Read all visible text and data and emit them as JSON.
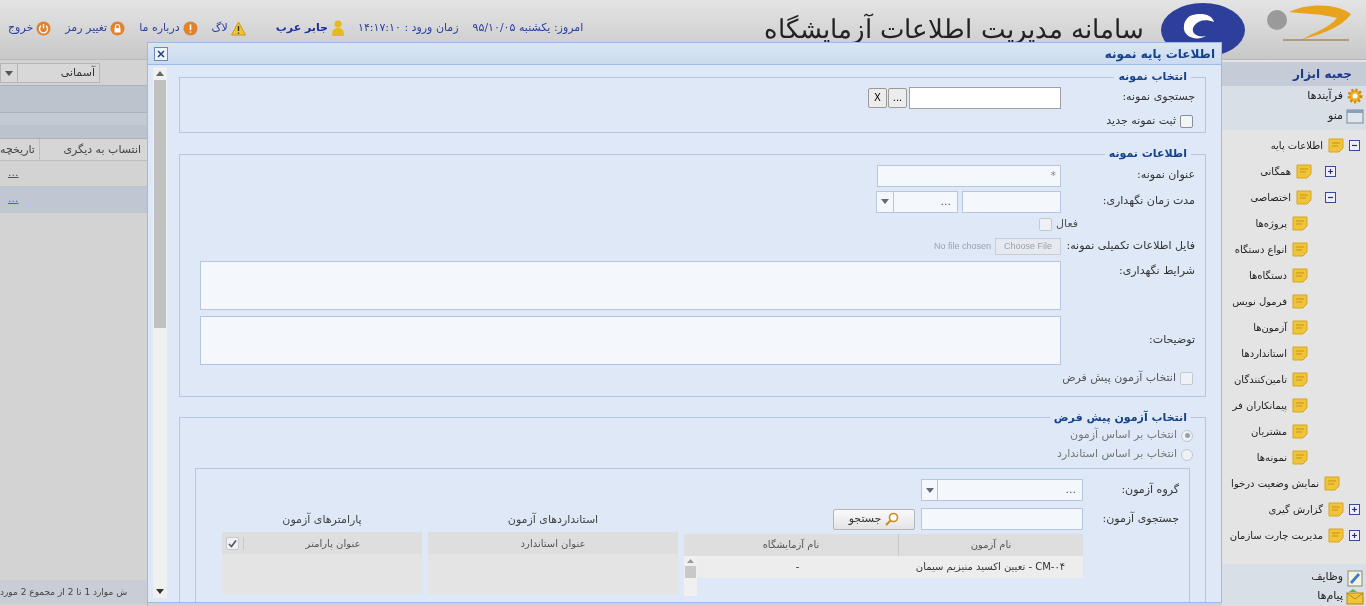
{
  "header": {
    "title": "سامانه مدیریت اطلاعات آزمایشگاه",
    "today": "امروز: یکشنبه ۹۵/۱۰/۰۵",
    "login_time": "زمان ورود : ۱۴:۱۷:۱۰",
    "user": "جابر عرب",
    "links": [
      {
        "kind": "log",
        "label": "لاگ"
      },
      {
        "kind": "about",
        "label": "درباره ما"
      },
      {
        "kind": "password",
        "label": "تغییر رمز"
      },
      {
        "kind": "exit",
        "label": "خروج"
      }
    ]
  },
  "background_panel": {
    "dropdown": "آسمانی",
    "columns": [
      "انتساب به دیگری",
      "تاریخچه"
    ],
    "rows": [
      {
        "link": "...",
        "selected": false
      },
      {
        "link": "...",
        "selected": true
      }
    ],
    "footer": "ش موارد 1 تا 2 از مجموع 2 مورد"
  },
  "sidebar": {
    "title": "جعبه ابزار",
    "sections": [
      {
        "kind": "processes",
        "label": "فرآیندها"
      },
      {
        "kind": "menu",
        "label": "منو"
      }
    ],
    "tree": [
      {
        "kind": "folder",
        "label": "اطلاعات پایه",
        "expanded": true,
        "children": [
          {
            "kind": "folder",
            "label": "همگانی",
            "expanded": false
          },
          {
            "kind": "folder",
            "label": "اختصاصی",
            "expanded": true,
            "children": [
              {
                "kind": "leaf",
                "label": "پروژه‌ها"
              },
              {
                "kind": "leaf",
                "label": "انواع دستگاه"
              },
              {
                "kind": "leaf",
                "label": "دستگاه‌ها"
              },
              {
                "kind": "leaf",
                "label": "فرمول نویس"
              },
              {
                "kind": "leaf",
                "label": "آزمون‌ها"
              },
              {
                "kind": "leaf",
                "label": "استانداردها"
              },
              {
                "kind": "leaf",
                "label": "تامین‌کنندگان"
              },
              {
                "kind": "leaf",
                "label": "پیمانکاران فر"
              },
              {
                "kind": "leaf",
                "label": "مشتریان"
              },
              {
                "kind": "leaf",
                "label": "نمونه‌ها"
              }
            ]
          }
        ]
      },
      {
        "kind": "leaf",
        "label": "نمایش وضعیت درخوا"
      },
      {
        "kind": "folder",
        "label": "گزارش گیری",
        "expanded": false
      },
      {
        "kind": "folder",
        "label": "مدیریت چارت سازمان",
        "expanded": false
      }
    ],
    "bottom": [
      {
        "kind": "tasks",
        "label": "وظایف"
      },
      {
        "kind": "messages",
        "label": "پیام‌ها"
      }
    ]
  },
  "dialog": {
    "title": "اطلاعات پایه نمونه",
    "select_sample": {
      "legend": "انتخاب نمونه",
      "search_label": "جستجوی نمونه:",
      "browse_button": "...",
      "clear_button": "X",
      "new_sample": {
        "label": "ثبت نمونه جدید",
        "checked": false
      }
    },
    "sample_info": {
      "legend": "اطلاعات نمونه",
      "title_label": "عنوان نمونه:",
      "title_placeholder": "*",
      "retention_label": "مدت زمان نگهداری:",
      "retention_unit": "...",
      "active": {
        "label": "فعال",
        "checked": false
      },
      "file_label": "فایل اطلاعات تکمیلی نمونه:",
      "file_button": "Choose File",
      "file_status": "No file chosen",
      "conditions_label": "شرایط نگهداری:",
      "description_label": "توضیحات:",
      "default_test": {
        "label": "انتخاب آزمون پیش فرض",
        "checked": false
      }
    },
    "default_test": {
      "legend": "انتخاب آزمون پیش فرض",
      "options": [
        {
          "label": "انتخاب بر اساس آزمون",
          "selected": true
        },
        {
          "label": "انتخاب بر اساس استاندارد",
          "selected": false
        }
      ],
      "group_label": "گروه آزمون:",
      "group_value": "...",
      "search_label": "جستجوی آزمون:",
      "search_button": "جستجو",
      "tests_table": {
        "columns": [
          "نام آزمون",
          "نام آزمایشگاه"
        ],
        "rows": [
          [
            "CM-۰۴ - تعیین اکسید منیزیم سیمان",
            "-"
          ]
        ]
      },
      "standards_title": "استانداردهای آزمون",
      "standards_columns": [
        "عنوان استاندارد"
      ],
      "params_title": "پارامترهای آزمون",
      "params_columns": [
        "عنوان پارامتر"
      ],
      "params_check_all": true
    }
  }
}
